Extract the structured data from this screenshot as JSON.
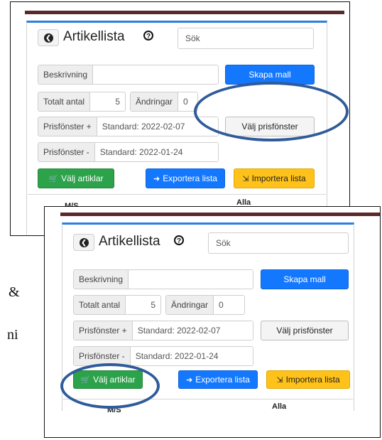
{
  "side_text": {
    "ampersand": "&",
    "ni": "ni"
  },
  "screens": [
    {
      "header": {
        "back_label": "❮",
        "title": "Artikellista",
        "help_label": "?"
      },
      "search": {
        "placeholder": "Sök"
      },
      "fields": {
        "beskrivning_label": "Beskrivning",
        "beskrivning_value": "",
        "totalt_label": "Totalt antal",
        "totalt_value": "5",
        "andringar_label": "Ändringar",
        "andringar_value": "0",
        "prisfonster_plus_label": "Prisfönster +",
        "prisfonster_plus_value": "Standard: 2022-02-07",
        "prisfonster_minus_label": "Prisfönster -",
        "prisfonster_minus_value": "Standard: 2022-01-24"
      },
      "buttons": {
        "skapa_mall": "Skapa mall",
        "valj_prisfonster": "Välj prisfönster",
        "valj_artiklar": "Välj artiklar",
        "exportera_lista": "Exportera lista",
        "importera_lista": "Importera lista"
      },
      "table_headers": {
        "left": "M/S",
        "right": "Alla"
      },
      "highlight": "valj_prisfonster"
    },
    {
      "header": {
        "back_label": "❮",
        "title": "Artikellista",
        "help_label": "?"
      },
      "search": {
        "placeholder": "Sök"
      },
      "fields": {
        "beskrivning_label": "Beskrivning",
        "beskrivning_value": "",
        "totalt_label": "Totalt antal",
        "totalt_value": "5",
        "andringar_label": "Ändringar",
        "andringar_value": "0",
        "prisfonster_plus_label": "Prisfönster +",
        "prisfonster_plus_value": "Standard: 2022-02-07",
        "prisfonster_minus_label": "Prisfönster -",
        "prisfonster_minus_value": "Standard: 2022-01-24"
      },
      "buttons": {
        "skapa_mall": "Skapa mall",
        "valj_prisfonster": "Välj prisfönster",
        "valj_artiklar": "Välj artiklar",
        "exportera_lista": "Exportera lista",
        "importera_lista": "Importera lista"
      },
      "table_headers": {
        "left": "M/S",
        "right": "Alla"
      },
      "highlight": "valj_artiklar"
    }
  ],
  "colors": {
    "accent": "#1478ff",
    "header_bar": "#5a2a2a",
    "highlight_ring": "#2f5b9a",
    "green": "#2ca24a",
    "yellow": "#ffc21a"
  }
}
